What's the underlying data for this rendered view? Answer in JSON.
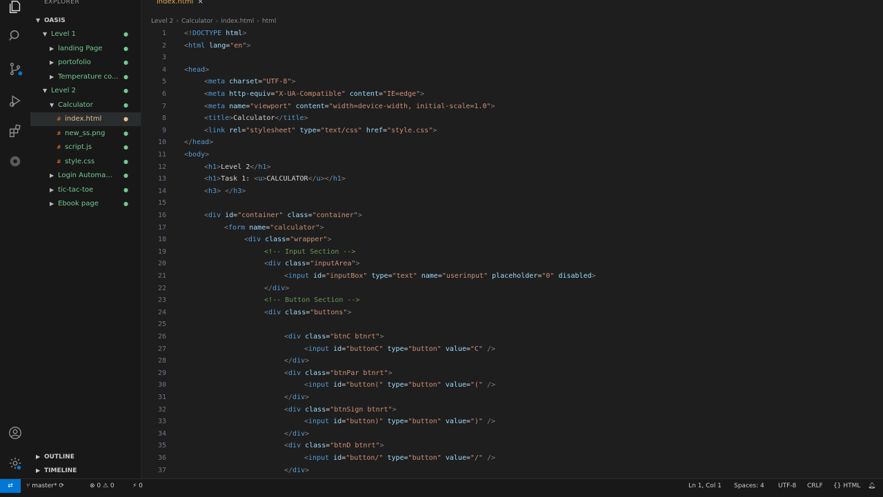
{
  "sidebar": {
    "header": "EXPLORER",
    "root": "OASIS",
    "tree": [
      {
        "label": "Level 1",
        "indent": 1,
        "chevron": "open",
        "color": "#73c991"
      },
      {
        "label": "landing Page",
        "indent": 2,
        "chevron": "closed",
        "color": "#73c991"
      },
      {
        "label": "portofolio",
        "indent": 2,
        "chevron": "closed",
        "color": "#73c991"
      },
      {
        "label": "Temperature co...",
        "indent": 2,
        "chevron": "closed",
        "color": "#73c991"
      },
      {
        "label": "Level 2",
        "indent": 1,
        "chevron": "open",
        "color": "#73c991"
      },
      {
        "label": "Calculator",
        "indent": 2,
        "chevron": "open",
        "color": "#73c991"
      },
      {
        "label": "index.html",
        "indent": 3,
        "chevron": "none",
        "color": "#e2c08d",
        "selected": true
      },
      {
        "label": "new_ss.png",
        "indent": 3,
        "chevron": "none",
        "color": "#73c991"
      },
      {
        "label": "script.js",
        "indent": 3,
        "chevron": "none",
        "color": "#73c991"
      },
      {
        "label": "style.css",
        "indent": 3,
        "chevron": "none",
        "color": "#73c991"
      },
      {
        "label": "Login Automa...",
        "indent": 2,
        "chevron": "closed",
        "color": "#73c991"
      },
      {
        "label": "tic-tac-toe",
        "indent": 2,
        "chevron": "closed",
        "color": "#73c991"
      },
      {
        "label": "Ebook page",
        "indent": 2,
        "chevron": "closed",
        "color": "#73c991"
      }
    ],
    "sections": [
      "OUTLINE",
      "TIMELINE"
    ]
  },
  "editor": {
    "tab": {
      "label": "index.html",
      "close": "×"
    },
    "breadcrumb": [
      "Level 2",
      "Calculator",
      "index.html",
      "html"
    ],
    "lines": [
      {
        "n": "1",
        "indent": 0,
        "tokens": [
          [
            "tag",
            "<!"
          ],
          [
            "name",
            "DOCTYPE "
          ],
          [
            "attr",
            "html"
          ],
          [
            "tag",
            ">"
          ]
        ]
      },
      {
        "n": "2",
        "indent": 0,
        "tokens": [
          [
            "tag",
            "<"
          ],
          [
            "name",
            "html "
          ],
          [
            "attr",
            "lang"
          ],
          [
            "text",
            "="
          ],
          [
            "str",
            "\"en\""
          ],
          [
            "tag",
            ">"
          ]
        ]
      },
      {
        "n": "3",
        "indent": 0,
        "tokens": []
      },
      {
        "n": "4",
        "indent": 0,
        "tokens": [
          [
            "tag",
            "<"
          ],
          [
            "name",
            "head"
          ],
          [
            "tag",
            ">"
          ]
        ]
      },
      {
        "n": "5",
        "indent": 1,
        "tokens": [
          [
            "tag",
            "<"
          ],
          [
            "name",
            "meta "
          ],
          [
            "attr",
            "charset"
          ],
          [
            "text",
            "="
          ],
          [
            "str",
            "\"UTF-8\""
          ],
          [
            "tag",
            ">"
          ]
        ]
      },
      {
        "n": "6",
        "indent": 1,
        "tokens": [
          [
            "tag",
            "<"
          ],
          [
            "name",
            "meta "
          ],
          [
            "attr",
            "http-equiv"
          ],
          [
            "text",
            "="
          ],
          [
            "str",
            "\"X-UA-Compatible\""
          ],
          [
            "attr",
            " content"
          ],
          [
            "text",
            "="
          ],
          [
            "str",
            "\"IE=edge\""
          ],
          [
            "tag",
            ">"
          ]
        ]
      },
      {
        "n": "7",
        "indent": 1,
        "tokens": [
          [
            "tag",
            "<"
          ],
          [
            "name",
            "meta "
          ],
          [
            "attr",
            "name"
          ],
          [
            "text",
            "="
          ],
          [
            "str",
            "\"viewport\""
          ],
          [
            "attr",
            " content"
          ],
          [
            "text",
            "="
          ],
          [
            "str",
            "\"width=device-width, initial-scale=1.0\""
          ],
          [
            "tag",
            ">"
          ]
        ]
      },
      {
        "n": "8",
        "indent": 1,
        "tokens": [
          [
            "tag",
            "<"
          ],
          [
            "name",
            "title"
          ],
          [
            "tag",
            ">"
          ],
          [
            "text",
            "Calculator"
          ],
          [
            "tag",
            "</"
          ],
          [
            "name",
            "title"
          ],
          [
            "tag",
            ">"
          ]
        ]
      },
      {
        "n": "9",
        "indent": 1,
        "tokens": [
          [
            "tag",
            "<"
          ],
          [
            "name",
            "link "
          ],
          [
            "attr",
            "rel"
          ],
          [
            "text",
            "="
          ],
          [
            "str",
            "\"stylesheet\""
          ],
          [
            "attr",
            " type"
          ],
          [
            "text",
            "="
          ],
          [
            "str",
            "\"text/css\""
          ],
          [
            "attr",
            " href"
          ],
          [
            "text",
            "="
          ],
          [
            "str",
            "\"style.css\""
          ],
          [
            "tag",
            ">"
          ]
        ]
      },
      {
        "n": "10",
        "indent": 0,
        "tokens": [
          [
            "tag",
            "</"
          ],
          [
            "name",
            "head"
          ],
          [
            "tag",
            ">"
          ]
        ]
      },
      {
        "n": "11",
        "indent": 0,
        "tokens": [
          [
            "tag",
            "<"
          ],
          [
            "name",
            "body"
          ],
          [
            "tag",
            ">"
          ]
        ]
      },
      {
        "n": "12",
        "indent": 1,
        "tokens": [
          [
            "tag",
            "<"
          ],
          [
            "name",
            "h1"
          ],
          [
            "tag",
            ">"
          ],
          [
            "text",
            "Level 2"
          ],
          [
            "tag",
            "</"
          ],
          [
            "name",
            "h1"
          ],
          [
            "tag",
            ">"
          ]
        ]
      },
      {
        "n": "13",
        "indent": 1,
        "tokens": [
          [
            "tag",
            "<"
          ],
          [
            "name",
            "h1"
          ],
          [
            "tag",
            ">"
          ],
          [
            "text",
            "Task 1: "
          ],
          [
            "tag",
            "<"
          ],
          [
            "name",
            "u"
          ],
          [
            "tag",
            ">"
          ],
          [
            "text",
            "CALCULATOR"
          ],
          [
            "tag",
            "</"
          ],
          [
            "name",
            "u"
          ],
          [
            "tag",
            "></"
          ],
          [
            "name",
            "h1"
          ],
          [
            "tag",
            ">"
          ]
        ]
      },
      {
        "n": "14",
        "indent": 1,
        "tokens": [
          [
            "tag",
            "<"
          ],
          [
            "name",
            "h3"
          ],
          [
            "tag",
            ">"
          ],
          [
            "text",
            " "
          ],
          [
            "tag",
            "</"
          ],
          [
            "name",
            "h3"
          ],
          [
            "tag",
            ">"
          ]
        ]
      },
      {
        "n": "15",
        "indent": 0,
        "tokens": []
      },
      {
        "n": "16",
        "indent": 1,
        "tokens": [
          [
            "tag",
            "<"
          ],
          [
            "name",
            "div "
          ],
          [
            "attr",
            "id"
          ],
          [
            "text",
            "="
          ],
          [
            "str",
            "\"container\""
          ],
          [
            "attr",
            " class"
          ],
          [
            "text",
            "="
          ],
          [
            "str",
            "\"container\""
          ],
          [
            "tag",
            ">"
          ]
        ]
      },
      {
        "n": "17",
        "indent": 2,
        "tokens": [
          [
            "tag",
            "<"
          ],
          [
            "name",
            "form "
          ],
          [
            "attr",
            "name"
          ],
          [
            "text",
            "="
          ],
          [
            "str",
            "\"calculator\""
          ],
          [
            "tag",
            ">"
          ]
        ]
      },
      {
        "n": "18",
        "indent": 3,
        "tokens": [
          [
            "tag",
            "<"
          ],
          [
            "name",
            "div "
          ],
          [
            "attr",
            "class"
          ],
          [
            "text",
            "="
          ],
          [
            "str",
            "\"wrapper\""
          ],
          [
            "tag",
            ">"
          ]
        ]
      },
      {
        "n": "19",
        "indent": 4,
        "tokens": [
          [
            "com",
            "<!-- Input Section -->"
          ]
        ]
      },
      {
        "n": "20",
        "indent": 4,
        "tokens": [
          [
            "tag",
            "<"
          ],
          [
            "name",
            "div "
          ],
          [
            "attr",
            "class"
          ],
          [
            "text",
            "="
          ],
          [
            "str",
            "\"inputArea\""
          ],
          [
            "tag",
            ">"
          ]
        ]
      },
      {
        "n": "21",
        "indent": 5,
        "tokens": [
          [
            "tag",
            "<"
          ],
          [
            "name",
            "input "
          ],
          [
            "attr",
            "id"
          ],
          [
            "text",
            "="
          ],
          [
            "str",
            "\"inputBox\""
          ],
          [
            "attr",
            " type"
          ],
          [
            "text",
            "="
          ],
          [
            "str",
            "\"text\""
          ],
          [
            "attr",
            " name"
          ],
          [
            "text",
            "="
          ],
          [
            "str",
            "\"userinput\""
          ],
          [
            "attr",
            " placeholder"
          ],
          [
            "text",
            "="
          ],
          [
            "str",
            "\"0\""
          ],
          [
            "attr",
            " disabled"
          ],
          [
            "tag",
            ">"
          ]
        ]
      },
      {
        "n": "22",
        "indent": 4,
        "tokens": [
          [
            "tag",
            "</"
          ],
          [
            "name",
            "div"
          ],
          [
            "tag",
            ">"
          ]
        ]
      },
      {
        "n": "23",
        "indent": 4,
        "tokens": [
          [
            "com",
            "<!-- Button Section -->"
          ]
        ]
      },
      {
        "n": "24",
        "indent": 4,
        "tokens": [
          [
            "tag",
            "<"
          ],
          [
            "name",
            "div "
          ],
          [
            "attr",
            "class"
          ],
          [
            "text",
            "="
          ],
          [
            "str",
            "\"buttons\""
          ],
          [
            "tag",
            ">"
          ]
        ]
      },
      {
        "n": "25",
        "indent": 0,
        "tokens": []
      },
      {
        "n": "26",
        "indent": 5,
        "tokens": [
          [
            "tag",
            "<"
          ],
          [
            "name",
            "div "
          ],
          [
            "attr",
            "class"
          ],
          [
            "text",
            "="
          ],
          [
            "str",
            "\"btnC btnrt\""
          ],
          [
            "tag",
            ">"
          ]
        ]
      },
      {
        "n": "27",
        "indent": 6,
        "tokens": [
          [
            "tag",
            "<"
          ],
          [
            "name",
            "input "
          ],
          [
            "attr",
            "id"
          ],
          [
            "text",
            "="
          ],
          [
            "str",
            "\"buttonC\""
          ],
          [
            "attr",
            " type"
          ],
          [
            "text",
            "="
          ],
          [
            "str",
            "\"button\""
          ],
          [
            "attr",
            " value"
          ],
          [
            "text",
            "="
          ],
          [
            "str",
            "\"C\""
          ],
          [
            "tag",
            " />"
          ]
        ]
      },
      {
        "n": "28",
        "indent": 5,
        "tokens": [
          [
            "tag",
            "</"
          ],
          [
            "name",
            "div"
          ],
          [
            "tag",
            ">"
          ]
        ]
      },
      {
        "n": "29",
        "indent": 5,
        "tokens": [
          [
            "tag",
            "<"
          ],
          [
            "name",
            "div "
          ],
          [
            "attr",
            "class"
          ],
          [
            "text",
            "="
          ],
          [
            "str",
            "\"btnPar btnrt\""
          ],
          [
            "tag",
            ">"
          ]
        ]
      },
      {
        "n": "30",
        "indent": 6,
        "tokens": [
          [
            "tag",
            "<"
          ],
          [
            "name",
            "input "
          ],
          [
            "attr",
            "id"
          ],
          [
            "text",
            "="
          ],
          [
            "str",
            "\"button(\""
          ],
          [
            "attr",
            " type"
          ],
          [
            "text",
            "="
          ],
          [
            "str",
            "\"button\""
          ],
          [
            "attr",
            " value"
          ],
          [
            "text",
            "="
          ],
          [
            "str",
            "\"(\""
          ],
          [
            "tag",
            " />"
          ]
        ]
      },
      {
        "n": "31",
        "indent": 5,
        "tokens": [
          [
            "tag",
            "</"
          ],
          [
            "name",
            "div"
          ],
          [
            "tag",
            ">"
          ]
        ]
      },
      {
        "n": "32",
        "indent": 5,
        "tokens": [
          [
            "tag",
            "<"
          ],
          [
            "name",
            "div "
          ],
          [
            "attr",
            "class"
          ],
          [
            "text",
            "="
          ],
          [
            "str",
            "\"btnSign btnrt\""
          ],
          [
            "tag",
            ">"
          ]
        ]
      },
      {
        "n": "33",
        "indent": 6,
        "tokens": [
          [
            "tag",
            "<"
          ],
          [
            "name",
            "input "
          ],
          [
            "attr",
            "id"
          ],
          [
            "text",
            "="
          ],
          [
            "str",
            "\"button)\""
          ],
          [
            "attr",
            " type"
          ],
          [
            "text",
            "="
          ],
          [
            "str",
            "\"button\""
          ],
          [
            "attr",
            " value"
          ],
          [
            "text",
            "="
          ],
          [
            "str",
            "\")\""
          ],
          [
            "tag",
            " />"
          ]
        ]
      },
      {
        "n": "34",
        "indent": 5,
        "tokens": [
          [
            "tag",
            "</"
          ],
          [
            "name",
            "div"
          ],
          [
            "tag",
            ">"
          ]
        ]
      },
      {
        "n": "35",
        "indent": 5,
        "tokens": [
          [
            "tag",
            "<"
          ],
          [
            "name",
            "div "
          ],
          [
            "attr",
            "class"
          ],
          [
            "text",
            "="
          ],
          [
            "str",
            "\"btnD btnrt\""
          ],
          [
            "tag",
            ">"
          ]
        ]
      },
      {
        "n": "36",
        "indent": 6,
        "tokens": [
          [
            "tag",
            "<"
          ],
          [
            "name",
            "input "
          ],
          [
            "attr",
            "id"
          ],
          [
            "text",
            "="
          ],
          [
            "str",
            "\"button/\""
          ],
          [
            "attr",
            " type"
          ],
          [
            "text",
            "="
          ],
          [
            "str",
            "\"button\""
          ],
          [
            "attr",
            " value"
          ],
          [
            "text",
            "="
          ],
          [
            "str",
            "\"/\""
          ],
          [
            "tag",
            " />"
          ]
        ]
      },
      {
        "n": "37",
        "indent": 5,
        "tokens": [
          [
            "tag",
            "</"
          ],
          [
            "name",
            "div"
          ],
          [
            "tag",
            ">"
          ]
        ]
      }
    ]
  },
  "status": {
    "branch": "master*",
    "problems": "⊗ 0 ⚠ 0",
    "ports": "⚡ 0",
    "position": "Ln 1, Col 1",
    "spaces": "Spaces: 4",
    "encoding": "UTF-8",
    "eol": "CRLF",
    "language": "HTML"
  },
  "colors": {
    "accent": "#0078d4",
    "git_added": "#73c991",
    "git_modified": "#e2c08d"
  }
}
